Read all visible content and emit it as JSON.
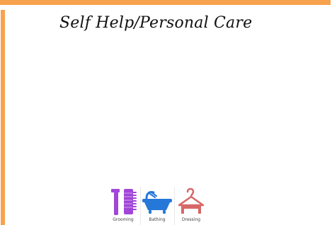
{
  "header": {
    "title": "Self Help/Personal Care"
  },
  "categories": [
    {
      "label": "Grooming",
      "icon": "grooming-icon",
      "color": "#a146d8"
    },
    {
      "label": "Bathing",
      "icon": "bathtub-icon",
      "color": "#2678d8"
    },
    {
      "label": "Dressing",
      "icon": "hanger-icon",
      "color": "#d66868"
    }
  ],
  "theme": {
    "accent_color": "#f7a24e",
    "background_color": "#ffffff",
    "text_color": "#111111"
  }
}
